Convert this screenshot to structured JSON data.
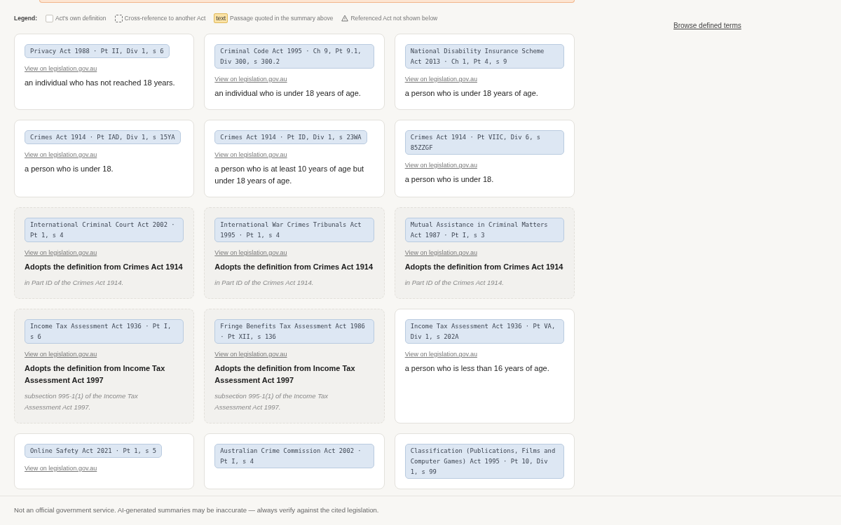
{
  "legend": {
    "label": "Legend:",
    "items": [
      {
        "kind": "own",
        "text": "Act's own definition"
      },
      {
        "kind": "crossref",
        "text": "Cross-reference to another Act"
      },
      {
        "kind": "quoted",
        "chip": "text",
        "text": "Passage quoted in the summary above"
      },
      {
        "kind": "missing",
        "text": "Referenced Act not shown below"
      }
    ]
  },
  "browse_link": "Browse defined terms",
  "cards": [
    {
      "kind": "own",
      "citation": "Privacy Act 1988 · Pt II, Div 1, s 6",
      "link": "View on legislation.gov.au",
      "definition": "an individual who has not reached 18 years."
    },
    {
      "kind": "own",
      "citation": "Criminal Code Act 1995 · Ch 9, Pt 9.1, Div 300, s 300.2",
      "link": "View on legislation.gov.au",
      "definition": "an individual who is under 18 years of age."
    },
    {
      "kind": "own",
      "citation": "National Disability Insurance Scheme Act 2013 · Ch 1, Pt 4, s 9",
      "link": "View on legislation.gov.au",
      "definition": "a person who is under 18 years of age."
    },
    {
      "kind": "own",
      "citation": "Crimes Act 1914 · Pt IAD, Div 1, s 15YA",
      "link": "View on legislation.gov.au",
      "definition": "a person who is under 18."
    },
    {
      "kind": "own",
      "citation": "Crimes Act 1914 · Pt ID, Div 1, s 23WA",
      "link": "View on legislation.gov.au",
      "definition": "a person who is at least 10 years of age but under 18 years of age."
    },
    {
      "kind": "own",
      "citation": "Crimes Act 1914 · Pt VIIC, Div 6, s 85ZZGF",
      "link": "View on legislation.gov.au",
      "definition": "a person who is under 18."
    },
    {
      "kind": "crossref",
      "citation": "International Criminal Court Act 2002 · Pt 1, s 4",
      "link": "View on legislation.gov.au",
      "definition": "Adopts the definition from Crimes Act 1914",
      "note": "in Part ID of the Crimes Act 1914."
    },
    {
      "kind": "crossref",
      "citation": "International War Crimes Tribunals Act 1995 · Pt 1, s 4",
      "link": "View on legislation.gov.au",
      "definition": "Adopts the definition from Crimes Act 1914",
      "note": "in Part ID of the Crimes Act 1914."
    },
    {
      "kind": "crossref",
      "citation": "Mutual Assistance in Criminal Matters Act 1987 · Pt I, s 3",
      "link": "View on legislation.gov.au",
      "definition": "Adopts the definition from Crimes Act 1914",
      "note": "in Part ID of the Crimes Act 1914."
    },
    {
      "kind": "crossref",
      "citation": "Income Tax Assessment Act 1936 · Pt I, s 6",
      "link": "View on legislation.gov.au",
      "definition": "Adopts the definition from Income Tax Assessment Act 1997",
      "note": "subsection 995-1(1) of the Income Tax Assessment Act 1997."
    },
    {
      "kind": "crossref",
      "citation": "Fringe Benefits Tax Assessment Act 1986 · Pt XII, s 136",
      "link": "View on legislation.gov.au",
      "definition": "Adopts the definition from Income Tax Assessment Act 1997",
      "note": "subsection 995-1(1) of the Income Tax Assessment Act 1997."
    },
    {
      "kind": "own",
      "citation": "Income Tax Assessment Act 1936 · Pt VA, Div 1, s 202A",
      "link": "View on legislation.gov.au",
      "definition": "a person who is less than 16 years of age."
    },
    {
      "kind": "own",
      "citation": "Online Safety Act 2021 · Pt 1, s 5",
      "link": "View on legislation.gov.au"
    },
    {
      "kind": "own",
      "citation": "Australian Crime Commission Act 2002 · Pt I, s 4"
    },
    {
      "kind": "own",
      "citation": "Classification (Publications, Films and Computer Games) Act 1995 · Pt 10, Div 1, s 99"
    }
  ],
  "footer": "Not an official government service. AI-generated summaries may be inaccurate — always verify against the cited legislation."
}
